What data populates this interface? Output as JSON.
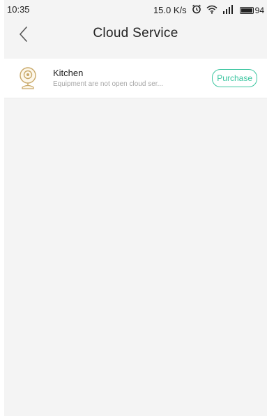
{
  "status_bar": {
    "time": "10:35",
    "network_speed": "15.0 K/s",
    "battery_level": "94",
    "icons": [
      "alarm-icon",
      "wifi-icon",
      "signal-icon",
      "battery-icon"
    ]
  },
  "header": {
    "title": "Cloud Service",
    "back_icon": "chevron-left-icon"
  },
  "devices": [
    {
      "name": "Kitchen",
      "status": "Equipment are not open cloud ser...",
      "icon": "camera-icon",
      "action_label": "Purchase"
    }
  ],
  "colors": {
    "accent": "#3cc6a0",
    "background": "#f4f4f4",
    "list_background": "#ffffff",
    "icon_gold": "#c9a96a"
  }
}
